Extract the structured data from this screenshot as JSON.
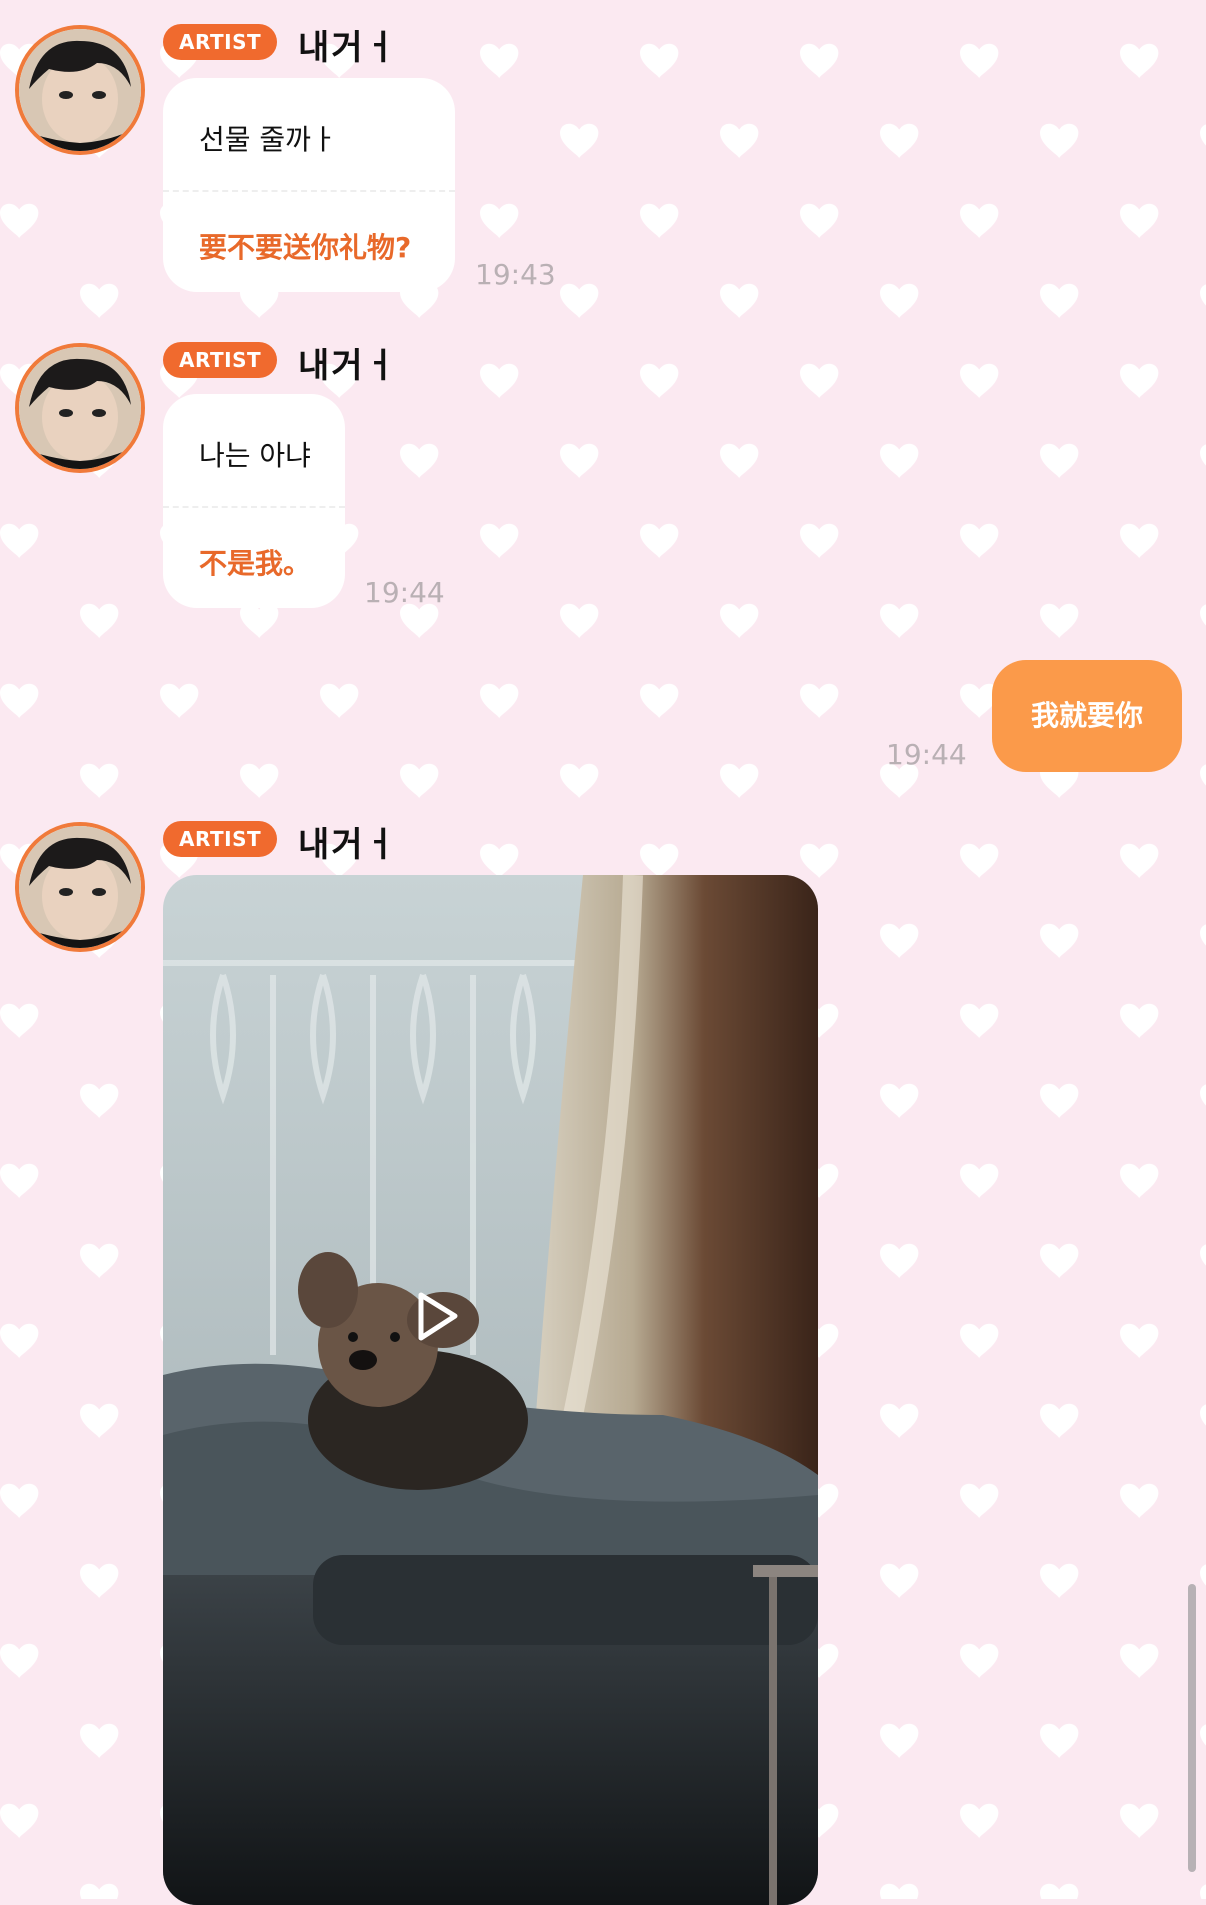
{
  "messages": [
    {
      "badge": "ARTIST",
      "sender": "내거ㅓ",
      "original": "선물 줄까ㅏ",
      "translation": "要不要送你礼物?",
      "time": "19:43"
    },
    {
      "badge": "ARTIST",
      "sender": "내거ㅓ",
      "original": "나는 아냐",
      "translation": "不是我。",
      "time": "19:44"
    }
  ],
  "my_message": {
    "text": "我就要你",
    "time": "19:44"
  },
  "video_message": {
    "badge": "ARTIST",
    "sender": "내거ㅓ",
    "media": "video-thumbnail-dog-on-bed",
    "play_icon": "play-icon"
  },
  "colors": {
    "background": "#fbe9f1",
    "heart": "#ffffff",
    "badge": "#f06a2e",
    "translation_text": "#e8692a",
    "my_bubble": "#fb9a4a",
    "time_text": "#b9b0b4"
  }
}
